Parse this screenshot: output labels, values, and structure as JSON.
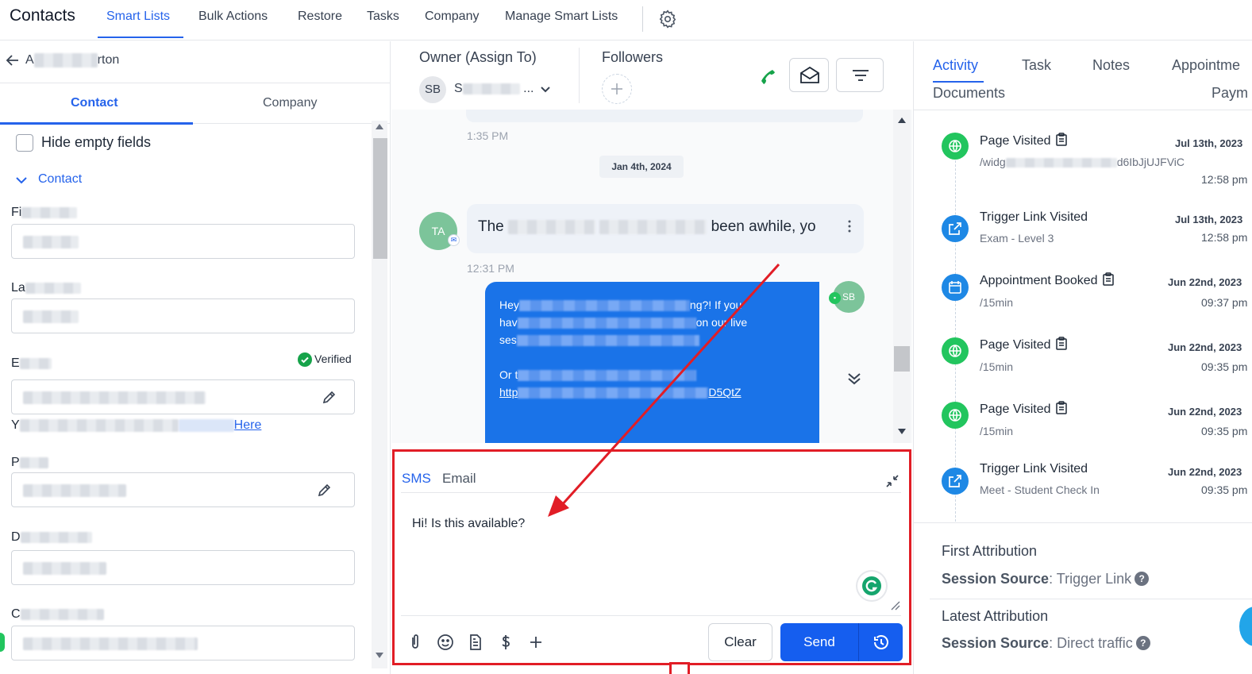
{
  "topnav": {
    "title": "Contacts",
    "tabs": [
      {
        "label": "Smart Lists"
      },
      {
        "label": "Bulk Actions"
      },
      {
        "label": "Restore"
      },
      {
        "label": "Tasks"
      },
      {
        "label": "Company"
      },
      {
        "label": "Manage Smart Lists"
      }
    ]
  },
  "contact": {
    "name_prefix": "A",
    "name_suffix": "rton",
    "tabs": [
      "Contact",
      "Company"
    ],
    "hide_empty_label": "Hide empty fields",
    "section_label": "Contact",
    "fields": [
      {
        "label_prefix": "Fi"
      },
      {
        "label_prefix": "La"
      },
      {
        "label_prefix": "E"
      },
      {
        "label_prefix": "P"
      },
      {
        "label_prefix": "D"
      },
      {
        "label_prefix": "C"
      }
    ],
    "verified_label": "Verified",
    "note_prefix": "Y",
    "here_link": "Here"
  },
  "conversation": {
    "owner_label": "Owner (Assign To)",
    "owner_initials": "SB",
    "owner_prefix": "S",
    "owner_ellipsis": "...",
    "followers_label": "Followers",
    "messages": {
      "time_1": "1:35 PM",
      "date_divider": "Jan 4th, 2024",
      "inbound_initials": "TA",
      "inbound_prefix": "The",
      "inbound_suffix": "been awhile, yo",
      "time_2": "12:31 PM",
      "outbound_initials": "SB",
      "outbound_lines": [
        {
          "start": "Hey",
          "end": "ng?! If you"
        },
        {
          "start": "hav",
          "end": "on our live"
        },
        {
          "start": "ses",
          "end": ""
        },
        {
          "start": "Or t",
          "end": ""
        },
        {
          "start": "http",
          "end": "D5QtZ"
        }
      ]
    },
    "composer": {
      "tabs": [
        "SMS",
        "Email"
      ],
      "active_tab": "SMS",
      "text": "Hi! Is this available?",
      "clear_label": "Clear",
      "send_label": "Send"
    }
  },
  "activity": {
    "tabs": [
      "Activity",
      "Task",
      "Notes",
      "Appointme",
      "Documents",
      "Paym"
    ],
    "items": [
      {
        "icon": "globe-icon",
        "color": "#22c55e",
        "title": "Page Visited",
        "sub": "/widg",
        "sub_end": "d6IbJjUJFViC",
        "date": "Jul 13th, 2023",
        "time": "12:58 pm",
        "clip": true
      },
      {
        "icon": "external-link-icon",
        "color": "#1e88e5",
        "title": "Trigger Link Visited",
        "sub": "Exam - Level 3",
        "sub_end": "",
        "date": "Jul 13th, 2023",
        "time": "12:58 pm",
        "clip": false
      },
      {
        "icon": "calendar-icon",
        "color": "#1e88e5",
        "title": "Appointment Booked",
        "sub": "/15min",
        "sub_end": "",
        "date": "Jun 22nd, 2023",
        "time": "09:37 pm",
        "clip": true
      },
      {
        "icon": "globe-icon",
        "color": "#22c55e",
        "title": "Page Visited",
        "sub": "/15min",
        "sub_end": "",
        "date": "Jun 22nd, 2023",
        "time": "09:35 pm",
        "clip": true
      },
      {
        "icon": "globe-icon",
        "color": "#22c55e",
        "title": "Page Visited",
        "sub": "/15min",
        "sub_end": "",
        "date": "Jun 22nd, 2023",
        "time": "09:35 pm",
        "clip": true
      },
      {
        "icon": "external-link-icon",
        "color": "#1e88e5",
        "title": "Trigger Link Visited",
        "sub": "Meet - Student Check In",
        "sub_end": "",
        "date": "Jun 22nd, 2023",
        "time": "09:35 pm",
        "clip": false
      }
    ],
    "first_attribution": {
      "title": "First Attribution",
      "key": "Session Source",
      "value": "Trigger Link"
    },
    "latest_attribution": {
      "title": "Latest Attribution",
      "key": "Session Source",
      "value": "Direct traffic"
    }
  },
  "colors": {
    "accent": "#2563eb",
    "annotation": "#e11d26",
    "send": "#155eef"
  }
}
